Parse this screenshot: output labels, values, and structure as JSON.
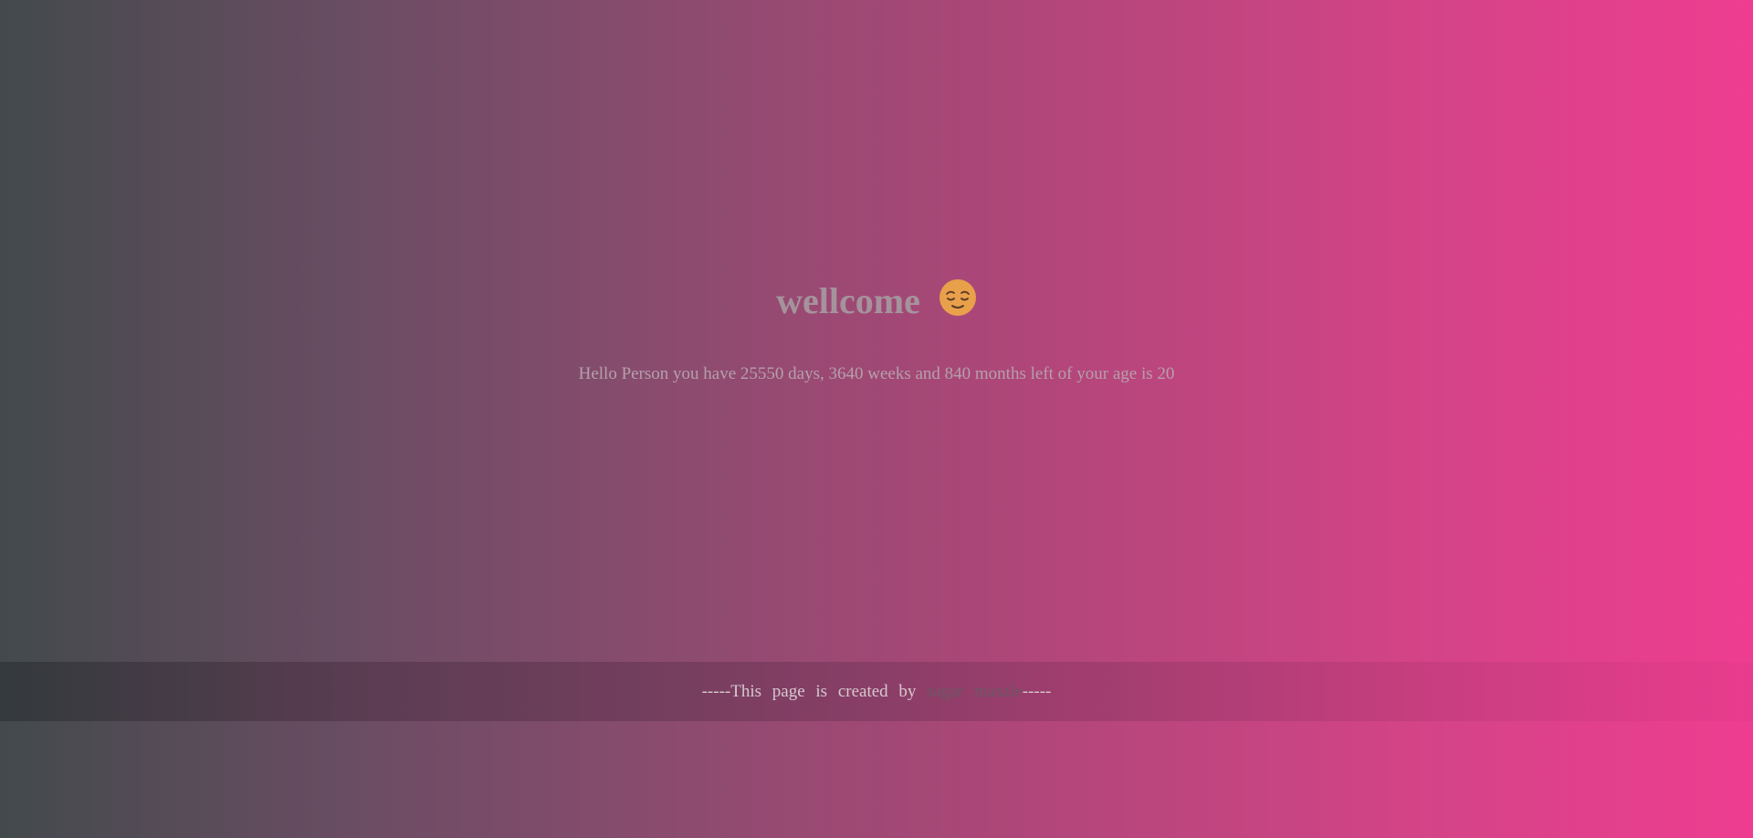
{
  "main": {
    "title": "wellcome",
    "title_emoji": "relieved-face-emoji",
    "message": "Hello Person you have 25550 days, 3640 weeks and 840 months left of your age is 20"
  },
  "footer": {
    "prefix": "-----This page is created by",
    "author": "sagar masale",
    "suffix": "-----"
  },
  "colors": {
    "gradient_start": "#434a4c",
    "gradient_end": "#ee3d91",
    "title_text": "#a5939c",
    "message_text": "#b5a0ab",
    "footer_text": "#d6c9cf",
    "author_text": "#6c5863"
  }
}
